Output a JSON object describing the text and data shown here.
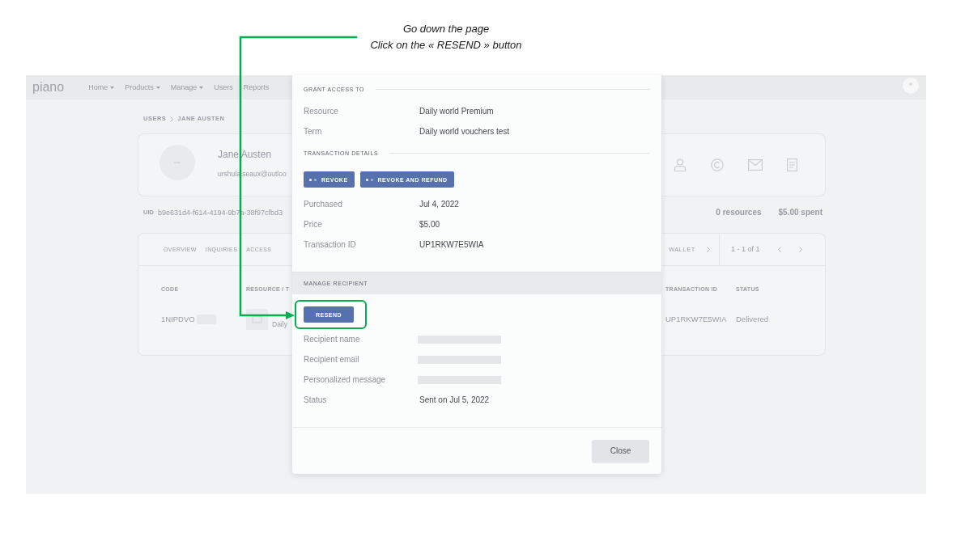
{
  "annotation": {
    "lines": [
      "Go down the page",
      "Click on the « RESEND » button"
    ]
  },
  "background_page": {
    "nav": {
      "logo": "piano",
      "items": [
        {
          "label": "Home",
          "dropdown": true
        },
        {
          "label": "Products",
          "dropdown": true
        },
        {
          "label": "Manage",
          "dropdown": true
        },
        {
          "label": "Users",
          "dropdown": false
        },
        {
          "label": "Reports",
          "dropdown": false
        }
      ]
    },
    "breadcrumb": [
      "USERS",
      "JANE AUSTEN"
    ],
    "profile": {
      "name": "Jane Austen",
      "email": "urshula.seaux@outloo"
    },
    "uid": {
      "label": "UID",
      "value": "b9e631d4-f614-4194-9b7a-38f97cfbd3"
    },
    "stats": [
      "0 resources",
      "$5.00 spent"
    ],
    "tabs": [
      "OVERVIEW",
      "INQUIRIES",
      "ACCESS"
    ],
    "wallet": {
      "label": "WALLET",
      "pagination": "1 - 1 of 1"
    },
    "table": {
      "columns": [
        "CODE",
        "RESOURCE / T",
        "TRANSACTION ID",
        "STATUS"
      ],
      "rows": [
        {
          "cells": [
            "1NIPDVO",
            "Daily",
            "UP1RKW7E5WIA",
            "Delivered"
          ]
        }
      ]
    }
  },
  "modal": {
    "sections": [
      {
        "kind": "details",
        "title": "GRANT ACCESS TO",
        "rows": [
          {
            "label": "Resource",
            "value": "Daily world Premium",
            "redacted": false
          },
          {
            "label": "Term",
            "value": "Daily world vouchers test",
            "redacted": false
          }
        ]
      },
      {
        "kind": "details",
        "title": "TRANSACTION DETAILS",
        "actions": [
          {
            "label": "REVOKE",
            "dots_icon": true,
            "highlighted": false
          },
          {
            "label": "REVOKE AND REFUND",
            "dots_icon": true,
            "highlighted": false
          }
        ],
        "rows": [
          {
            "label": "Purchased",
            "value": "Jul 4, 2022",
            "redacted": false
          },
          {
            "label": "Price",
            "value": "$5.00",
            "redacted": false
          },
          {
            "label": "Transaction ID",
            "value": "UP1RKW7E5WIA",
            "redacted": false
          }
        ]
      },
      {
        "kind": "panel",
        "title": "MANAGE RECIPIENT",
        "actions": [
          {
            "label": "RESEND",
            "dots_icon": false,
            "highlighted": true
          }
        ],
        "rows": [
          {
            "label": "Recipient name",
            "redacted": true
          },
          {
            "label": "Recipient email",
            "redacted": true
          },
          {
            "label": "Personalized message",
            "redacted": true
          },
          {
            "label": "Status",
            "value": "Sent on Jul 5, 2022",
            "redacted": false
          }
        ]
      }
    ],
    "footer": {
      "buttons": [
        "Close"
      ]
    }
  }
}
